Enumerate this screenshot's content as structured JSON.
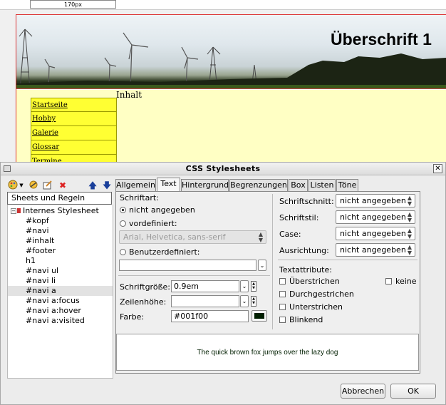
{
  "editor": {
    "ruler_label": "170px",
    "heading": "Überschrift 1",
    "content_label": "Inhalt",
    "navi": [
      "Startseite",
      "Hobby",
      "Galerie",
      "Glossar",
      "Termine"
    ]
  },
  "dialog": {
    "title": "CSS Stylesheets",
    "toolbar_icons": [
      "palette-icon",
      "dropdown-arrow-icon",
      "link-icon",
      "edit-icon",
      "delete-icon",
      "arrow-up-icon",
      "arrow-down-icon"
    ],
    "tree_header": "Sheets und Regeln",
    "tree_root": "Internes Stylesheet",
    "tree_items": [
      "#kopf",
      "#navi",
      "#inhalt",
      "#footer",
      "h1",
      "#navi ul",
      "#navi li",
      "#navi a",
      "#navi a:focus",
      "#navi a:hover",
      "#navi a:visited"
    ],
    "selected_item": "#navi a",
    "tabs": [
      "Allgemein",
      "Text",
      "Hintergrund",
      "Begrenzungen",
      "Box",
      "Listen",
      "Töne"
    ],
    "active_tab": "Text",
    "text_tab": {
      "schriftart_label": "Schriftart:",
      "radio_none": "nicht angegeben",
      "radio_predefined": "vordefiniert:",
      "predefined_value": "Arial, Helvetica, sans-serif",
      "radio_custom": "Benutzerdefiniert:",
      "custom_value": "",
      "size_label": "Schriftgröße:",
      "size_value": "0.9em",
      "lineheight_label": "Zeilenhöhe:",
      "lineheight_value": "",
      "color_label": "Farbe:",
      "color_value": "#001f00",
      "swatch_color": "#001f00",
      "schnitt_label": "Schriftschnitt:",
      "schnitt_value": "nicht angegeben",
      "stil_label": "Schriftstil:",
      "stil_value": "nicht angegeben",
      "case_label": "Case:",
      "case_value": "nicht angegeben",
      "ausrichtung_label": "Ausrichtung:",
      "ausrichtung_value": "nicht angegeben",
      "attr_label": "Textattribute:",
      "attr_overline": "Überstrichen",
      "attr_none": "keine",
      "attr_strike": "Durchgestrichen",
      "attr_underline": "Unterstrichen",
      "attr_blink": "Blinkend",
      "preview": "The quick brown fox jumps over the lazy dog"
    },
    "cancel_label": "Abbrechen",
    "ok_label": "OK"
  }
}
